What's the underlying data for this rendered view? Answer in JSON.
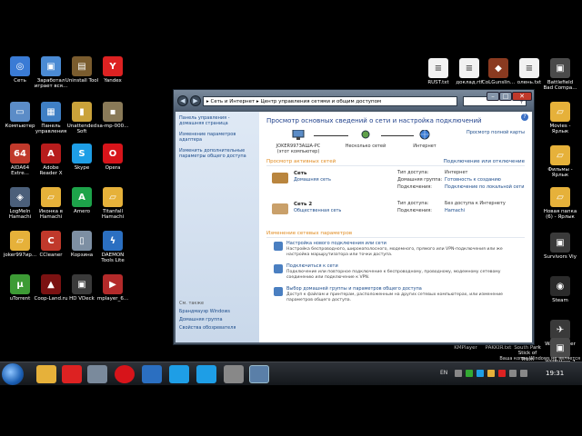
{
  "desktop": {
    "left_icons": [
      {
        "label": "Сеть",
        "color": "#3a7bd5",
        "glyph": "◎"
      },
      {
        "label": "Заработал\nиграет вся...",
        "color": "#4b8bd4",
        "glyph": "▣"
      },
      {
        "label": "Uninstall Tool",
        "color": "#7a5c2e",
        "glyph": "▤"
      },
      {
        "label": "Yandex",
        "color": "#d22",
        "glyph": "Y"
      },
      {
        "label": "Компьютер",
        "color": "#5b8cc7",
        "glyph": "▭"
      },
      {
        "label": "Панель\nуправления",
        "color": "#3f7fc4",
        "glyph": "▦"
      },
      {
        "label": "Unattended\nSoft",
        "color": "#caa23a",
        "glyph": "▮"
      },
      {
        "label": "sa-mp-000...",
        "color": "#8a7a58",
        "glyph": "▪"
      },
      {
        "label": "AIDA64\nExtre...",
        "color": "#c0392b",
        "glyph": "64"
      },
      {
        "label": "Adobe\nReader X",
        "color": "#b71c1c",
        "glyph": "A"
      },
      {
        "label": "Skype",
        "color": "#1e9ee6",
        "glyph": "S"
      },
      {
        "label": "Opera",
        "color": "#d7141a",
        "glyph": "O"
      },
      {
        "label": "LogMeIn\nHamachi",
        "color": "#4b5f7a",
        "glyph": "◈"
      },
      {
        "label": "Иконка в\nHamachi",
        "color": "#e6b13a",
        "glyph": "▱"
      },
      {
        "label": "Amero",
        "color": "#1da34a",
        "glyph": "A"
      },
      {
        "label": "Titanfall\nHamachi",
        "color": "#e6b13a",
        "glyph": "▱"
      },
      {
        "label": "joker997ир...",
        "color": "#e6b13a",
        "glyph": "▱"
      },
      {
        "label": "CCleaner",
        "color": "#c0392b",
        "glyph": "C"
      },
      {
        "label": "Корзина",
        "color": "#7d8fa3",
        "glyph": "▯"
      },
      {
        "label": "DAEMON\nTools Lite",
        "color": "#2b6fc1",
        "glyph": "ϟ"
      },
      {
        "label": "uTorrent",
        "color": "#3d9b35",
        "glyph": "µ"
      },
      {
        "label": "Coop-Land.ru",
        "color": "#7b1212",
        "glyph": "▲"
      },
      {
        "label": "HD VDeck",
        "color": "#3a3a3a",
        "glyph": "▣"
      },
      {
        "label": "mplayer_6...",
        "color": "#b32a2a",
        "glyph": "▶"
      }
    ],
    "right_icons": [
      {
        "label": "RUST.txt",
        "color": "#f2f2f2",
        "glyph": "≡"
      },
      {
        "label": "доклад.rtf",
        "color": "#f2f2f2",
        "glyph": "≡"
      },
      {
        "label": "CoLGunslin...",
        "color": "#8a3a20",
        "glyph": "◆"
      },
      {
        "label": "олень.txt",
        "color": "#f2f2f2",
        "glyph": "≡"
      },
      {
        "label": "Battlefield\nBad Compa...",
        "color": "#4a4a4a",
        "glyph": "▣"
      },
      {
        "label": "Movies -\nЯрлык",
        "color": "#e6b13a",
        "glyph": "▱"
      },
      {
        "label": "Фильмы -\nЯрлык",
        "color": "#e6b13a",
        "glyph": "▱"
      },
      {
        "label": "Новая папка\n(6) - Ярлык",
        "color": "#e6b13a",
        "glyph": "▱"
      },
      {
        "label": "Survivors Viy",
        "color": "#3a3a3a",
        "glyph": "▣"
      },
      {
        "label": "Steam",
        "color": "#2b2b2b",
        "glyph": "◉"
      },
      {
        "label": "WarThunder",
        "color": "#3a3a3a",
        "glyph": "✈"
      },
      {
        "label": "WillBitters 7\nTanks 7009",
        "color": "#4a4a4a",
        "glyph": "▣"
      }
    ],
    "bottom_labels": [
      {
        "label": "KMPlayer"
      },
      {
        "label": "PAKKIЯ.txt"
      },
      {
        "label": "South Park\nStick of Truth"
      }
    ]
  },
  "window": {
    "address": "▸ Сеть и Интернет ▸ Центр управления сетями и общим доступом",
    "search_icon": "search-icon",
    "min_label": "–",
    "max_label": "□",
    "close_label": "✕",
    "back_label": "◀",
    "forward_label": "▶",
    "left_pane": {
      "links": [
        "Панель управления - домашняя страница",
        "Изменение параметров адаптера",
        "Изменить дополнительные параметры общего доступа"
      ],
      "see_also": "См. также",
      "bottom_links": [
        "Брандмауэр Windows",
        "Домашняя группа",
        "Свойства обозревателя"
      ]
    },
    "main": {
      "title": "Просмотр основных сведений о сети и настройка подключений",
      "full_map": "Просмотр полной карты",
      "map": {
        "node1": "JOKER997ЗАША-PC\n(этот компьютер)",
        "node2": "Несколько сетей",
        "node3": "Интернет"
      },
      "active_networks_title": "Просмотр активных сетей",
      "connect_disconnect": "Подключение или отключение",
      "networks": [
        {
          "name": "Сеть",
          "type": "Домашняя сеть",
          "access_label": "Тип доступа:",
          "access_value": "Интернет",
          "homegroup_label": "Домашняя группа:",
          "homegroup_value": "Готовность к созданию",
          "connections_label": "Подключения:",
          "connections_value": "Подключение по локальной сети"
        },
        {
          "name": "Сеть  2",
          "type": "Общественная сеть",
          "access_label": "Тип доступа:",
          "access_value": "Без доступа к Интернету",
          "connections_label": "Подключения:",
          "connections_value": "Hamachi"
        }
      ],
      "change_title": "Изменение сетевых параметров",
      "tasks": [
        {
          "title": "Настройка нового подключения или сети",
          "desc": "Настройка беспроводного, широкополосного, модемного, прямого или VPN-подключения или же настройка маршрутизатора или точки доступа."
        },
        {
          "title": "Подключиться к сети",
          "desc": "Подключение или повторное подключение к беспроводному, проводному, модемному сетевому соединению или подключение к VPN."
        },
        {
          "title": "Выбор домашней группы и параметров общего доступа",
          "desc": "Доступ к файлам и принтерам, расположенным на других сетевых компьютерах, или изменение параметров общего доступа."
        }
      ]
    }
  },
  "taskbar": {
    "lang": "EN",
    "clock": "19:31"
  },
  "watermark": "Ваша копия Windows не является подлинной"
}
